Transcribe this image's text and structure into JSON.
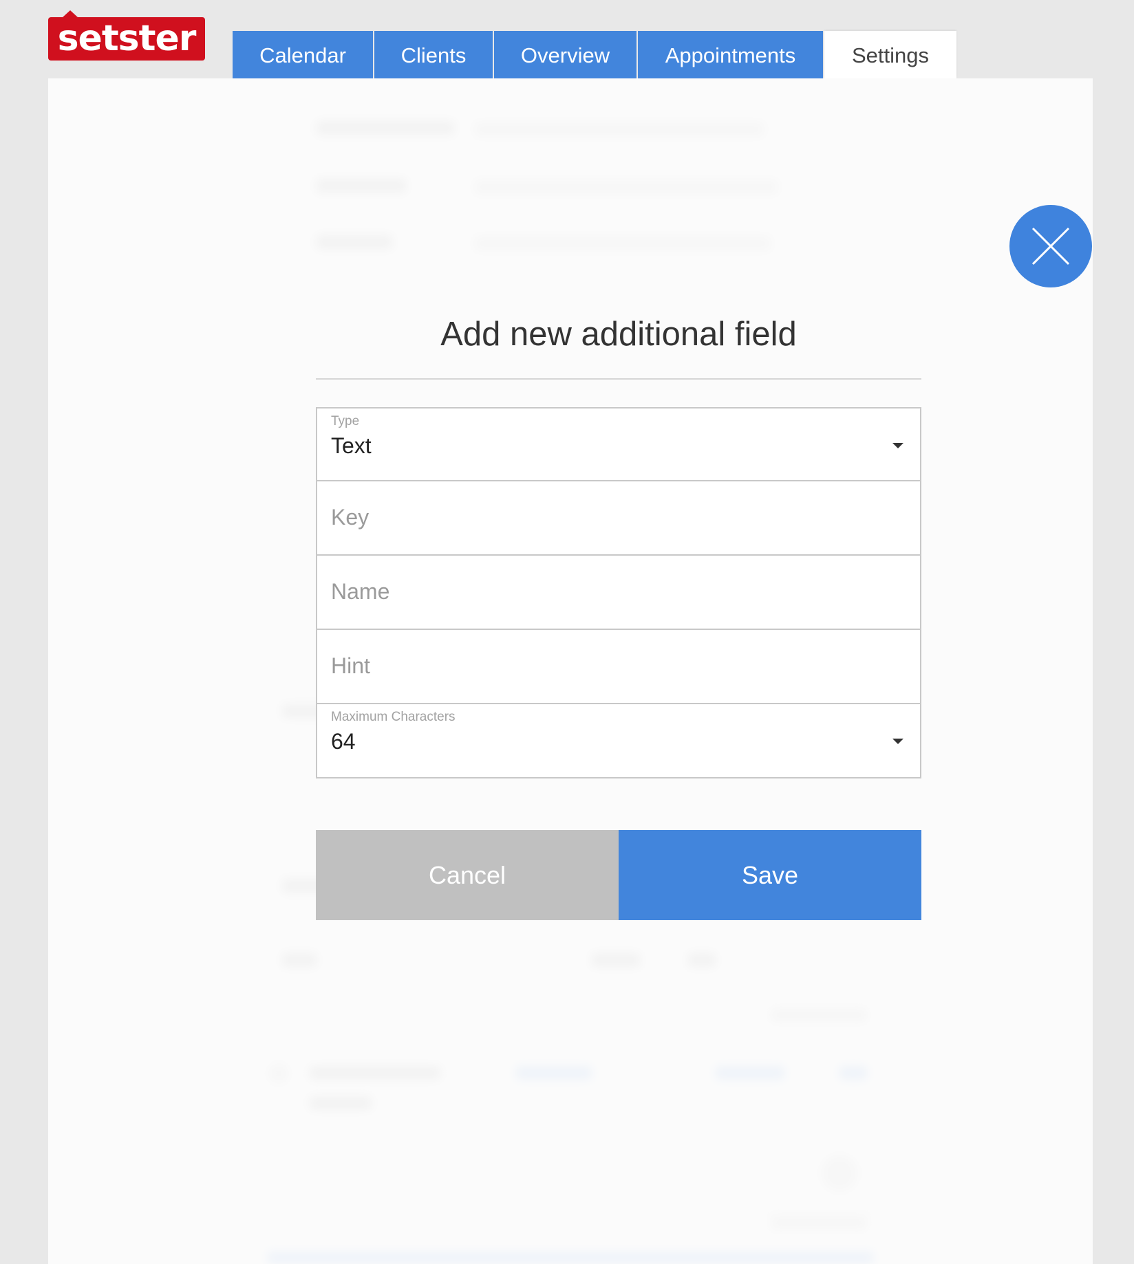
{
  "app": {
    "logo_text": "setster",
    "brand_color": "#d0101e",
    "accent_color": "#4285dc"
  },
  "nav": {
    "tabs": [
      {
        "label": "Calendar",
        "active": false
      },
      {
        "label": "Clients",
        "active": false
      },
      {
        "label": "Overview",
        "active": false
      },
      {
        "label": "Appointments",
        "active": false
      },
      {
        "label": "Settings",
        "active": true
      }
    ]
  },
  "dialog": {
    "title": "Add new additional field",
    "close_icon": "close-icon",
    "type_field": {
      "label": "Type",
      "value": "Text"
    },
    "key_field": {
      "placeholder": "Key",
      "value": ""
    },
    "name_field": {
      "placeholder": "Name",
      "value": ""
    },
    "hint_field": {
      "placeholder": "Hint",
      "value": ""
    },
    "max_chars_field": {
      "label": "Maximum Characters",
      "value": "64"
    },
    "cancel_label": "Cancel",
    "save_label": "Save"
  }
}
